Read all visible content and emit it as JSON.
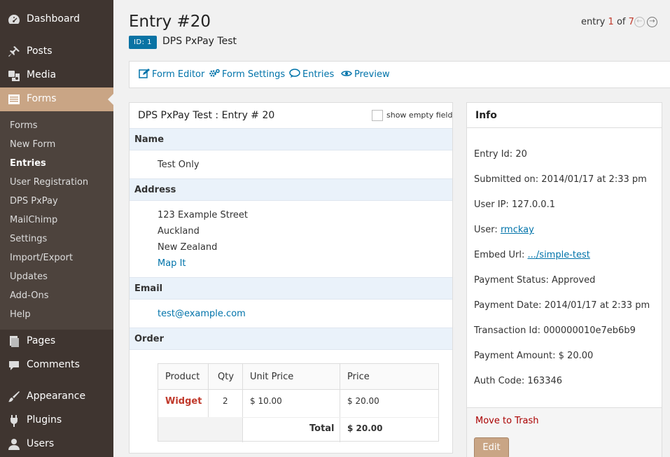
{
  "sidebar": {
    "menu": [
      {
        "label": "Dashboard",
        "icon": "dashboard-icon"
      },
      {
        "label": "Posts",
        "icon": "pin-icon"
      },
      {
        "label": "Media",
        "icon": "media-icon"
      },
      {
        "label": "Forms",
        "icon": "forms-icon"
      }
    ],
    "submenu": [
      "Forms",
      "New Form",
      "Entries",
      "User Registration",
      "DPS PxPay",
      "MailChimp",
      "Settings",
      "Import/Export",
      "Updates",
      "Add-Ons",
      "Help"
    ],
    "menu_bottom": [
      {
        "label": "Pages",
        "icon": "pages-icon"
      },
      {
        "label": "Comments",
        "icon": "comment-icon"
      },
      {
        "label": "Appearance",
        "icon": "brush-icon"
      },
      {
        "label": "Plugins",
        "icon": "plugin-icon"
      },
      {
        "label": "Users",
        "icon": "user-icon"
      }
    ]
  },
  "header": {
    "title": "Entry #20",
    "id_badge": "ID: 1",
    "form_name": "DPS PxPay Test",
    "pager": {
      "prefix": "entry",
      "current": "1",
      "of": "of",
      "total": "7"
    }
  },
  "toolbar": {
    "form_editor": "Form Editor",
    "form_settings": "Form Settings",
    "entries": "Entries",
    "preview": "Preview"
  },
  "entry": {
    "title": "DPS PxPay Test : Entry # 20",
    "show_empty_label": "show empty fields",
    "name_label": "Name",
    "name_value": "Test Only",
    "address_label": "Address",
    "address_lines": [
      "123 Example Street",
      "Auckland",
      "New Zealand"
    ],
    "map_it": "Map It",
    "email_label": "Email",
    "email_value": "test@example.com",
    "order_label": "Order",
    "order": {
      "headers": [
        "Product",
        "Qty",
        "Unit Price",
        "Price"
      ],
      "row": {
        "product": "Widget",
        "qty": "2",
        "unit_price": "$ 10.00",
        "price": "$ 20.00"
      },
      "total_label": "Total",
      "total_value": "$ 20.00"
    }
  },
  "info": {
    "title": "Info",
    "entry_id": "Entry Id: 20",
    "submitted_on": "Submitted on: 2014/01/17 at 2:33 pm",
    "user_ip": "User IP: 127.0.0.1",
    "user_label": "User:",
    "user_link": "rmckay",
    "embed_label": "Embed Url:",
    "embed_link": ".../simple-test",
    "payment_status": "Payment Status: Approved",
    "payment_date": "Payment Date: 2014/01/17 at 2:33 pm",
    "transaction_id": "Transaction Id: 000000010e7eb6b9",
    "payment_amount": "Payment Amount: $ 20.00",
    "auth_code": "Auth Code: 163346",
    "trash": "Move to Trash",
    "edit": "Edit"
  },
  "colors": {
    "sidebar": "#3f3530",
    "submenu": "#4d433d",
    "accent": "#c9a585",
    "link": "#0073aa",
    "badge": "#0a73a4"
  }
}
